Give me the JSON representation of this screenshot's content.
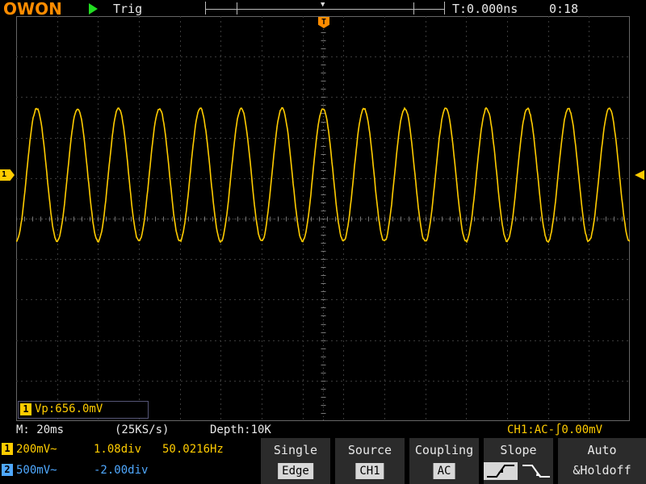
{
  "header": {
    "brand": "OWON",
    "run_state": "Trig",
    "trigger_time": "T:0.000ns",
    "clock": "0:18"
  },
  "markers": {
    "trigger_position": "T",
    "channel1": "1"
  },
  "measurement": {
    "channel": "1",
    "value": "Vp:656.0mV"
  },
  "status": {
    "timebase": "M: 20ms",
    "sample_rate": "(25KS/s)",
    "depth": "Depth:10K",
    "trigger": "CH1:AC-∫0.00mV"
  },
  "channels": [
    {
      "num": "1",
      "scale": "200mV~",
      "offset": "1.08div",
      "frequency": "50.0216Hz",
      "color": "#ffcc00"
    },
    {
      "num": "2",
      "scale": "500mV~",
      "offset": "-2.00div",
      "frequency": "",
      "color": "#4fa8ff"
    }
  ],
  "menu": {
    "mode": {
      "label": "Single",
      "value": "Edge"
    },
    "source": {
      "label": "Source",
      "value": "CH1"
    },
    "coupling": {
      "label": "Coupling",
      "value": "AC"
    },
    "slope": {
      "label": "Slope",
      "selected": "rising"
    },
    "auto": {
      "label": "Auto",
      "label2": "&Holdoff"
    }
  },
  "icons": {
    "run": "play-triangle-icon",
    "rising": "rising-edge-icon",
    "falling": "falling-edge-icon"
  }
}
